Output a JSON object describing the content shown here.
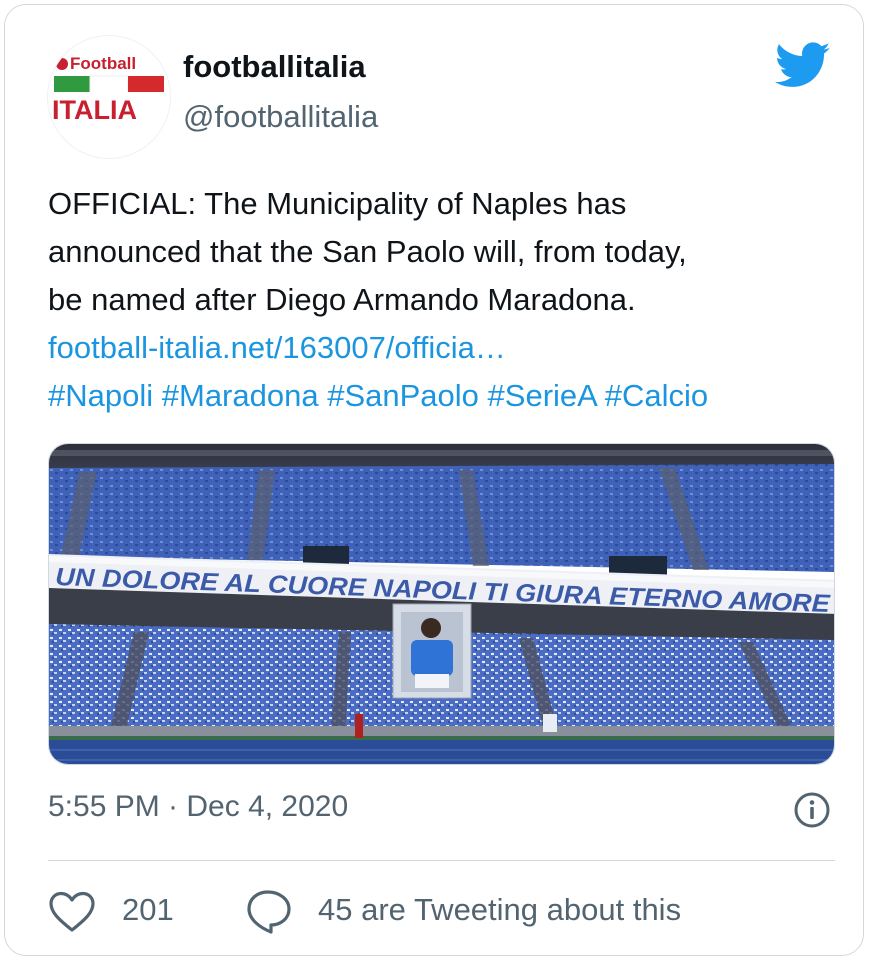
{
  "author": {
    "name": "footballitalia",
    "handle": "@footballitalia",
    "avatar": {
      "logo_top": "Football",
      "logo_bottom": "ITALIA"
    }
  },
  "tweet": {
    "lines": [
      "OFFICIAL: The Municipality of Naples has",
      "announced that the San Paolo will, from today,",
      "be named after Diego Armando Maradona."
    ],
    "link": "football-italia.net/163007/officia…",
    "hashtags": [
      "#Napoli",
      "#Maradona",
      "#SanPaolo",
      "#SerieA",
      "#Calcio"
    ]
  },
  "media": {
    "banner_text": "UN DOLORE AL CUORE NAPOLI TI GIURA ETERNO AMORE"
  },
  "meta": {
    "timestamp": "5:55 PM · Dec 4, 2020"
  },
  "actions": {
    "likes": "201",
    "conversation": "45 are Tweeting about this"
  },
  "colors": {
    "link": "#1b95e0",
    "twitter_blue": "#1d9bf0",
    "text": "#0f1419",
    "muted": "#536471"
  },
  "icons": [
    "twitter-bird-icon",
    "info-icon",
    "heart-icon",
    "speech-bubble-icon"
  ]
}
